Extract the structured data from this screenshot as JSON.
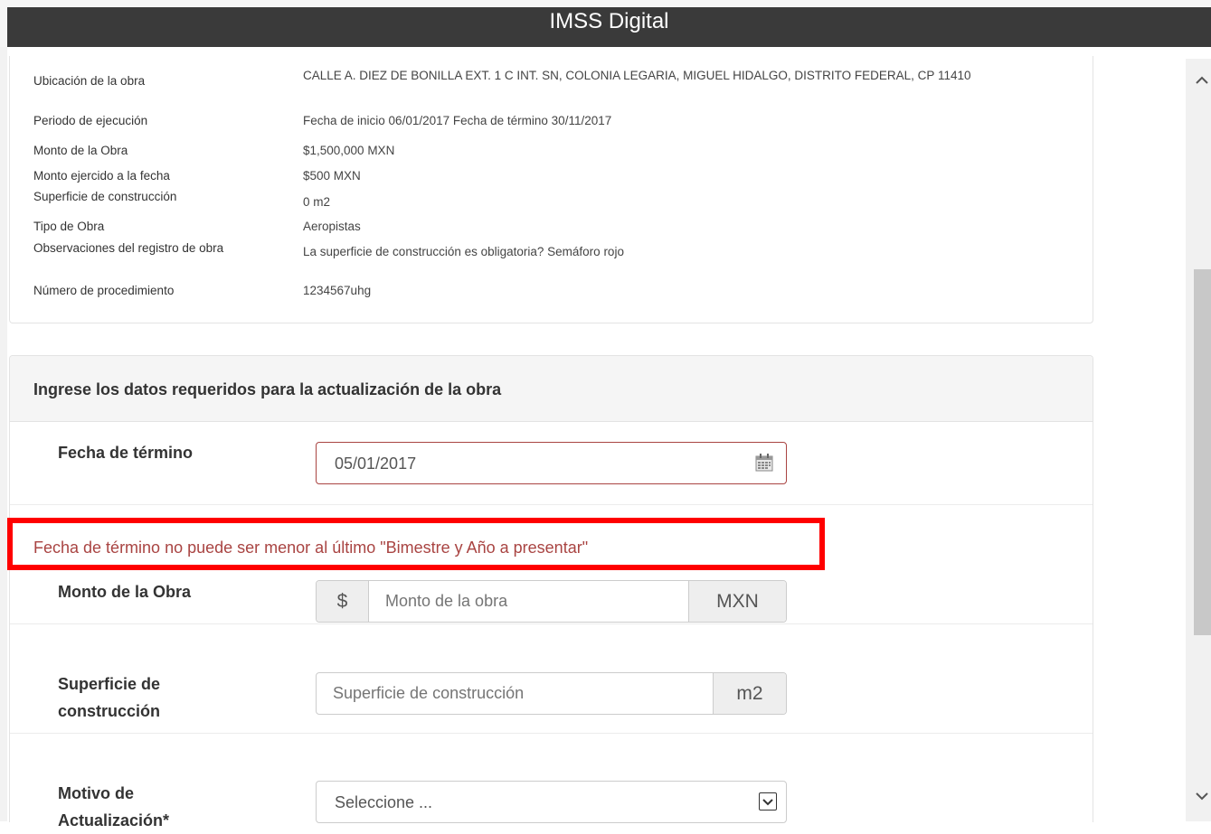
{
  "header": {
    "title": "IMSS Digital"
  },
  "info": {
    "rows": [
      {
        "label": "Ubicación de la obra",
        "value": "CALLE A. DIEZ DE BONILLA EXT. 1 C INT. SN, COLONIA LEGARIA, MIGUEL HIDALGO, DISTRITO FEDERAL, CP 11410"
      },
      {
        "label": "Periodo de ejecución",
        "value": "Fecha de inicio 06/01/2017 Fecha de término 30/11/2017"
      },
      {
        "label": "Monto de la Obra",
        "value": "$1,500,000 MXN"
      },
      {
        "label": "Monto ejercido a la fecha",
        "value": "$500 MXN"
      },
      {
        "label": "Superficie de construcción",
        "value": "0  m2"
      },
      {
        "label": "Tipo de Obra",
        "value": "Aeropistas"
      },
      {
        "label": "Observaciones del registro de obra",
        "value": "La superficie de construcción es obligatoria? Semáforo rojo"
      },
      {
        "label": "Número de procedimiento",
        "value": "1234567uhg"
      }
    ]
  },
  "form": {
    "title": "Ingrese los datos requeridos para la actualización de la obra",
    "fecha_termino": {
      "label": "Fecha de término",
      "value": "05/01/2017",
      "icon": "calendar-icon"
    },
    "error_message": "Fecha de término no puede ser menor al último \"Bimestre y Año a presentar\"",
    "monto": {
      "label": "Monto de la Obra",
      "prefix": "$",
      "placeholder": "Monto de la obra",
      "suffix": "MXN"
    },
    "superficie": {
      "label_line1": "Superficie de",
      "label_line2": "construcción",
      "placeholder": "Superficie de construcción",
      "suffix": "m2"
    },
    "motivo": {
      "label_line1": "Motivo de",
      "label_line2": "Actualización*",
      "selected": "Seleccione ..."
    }
  },
  "colors": {
    "error": "#a94442",
    "highlight": "#ff0000",
    "header_bg": "#3a3a3a"
  }
}
